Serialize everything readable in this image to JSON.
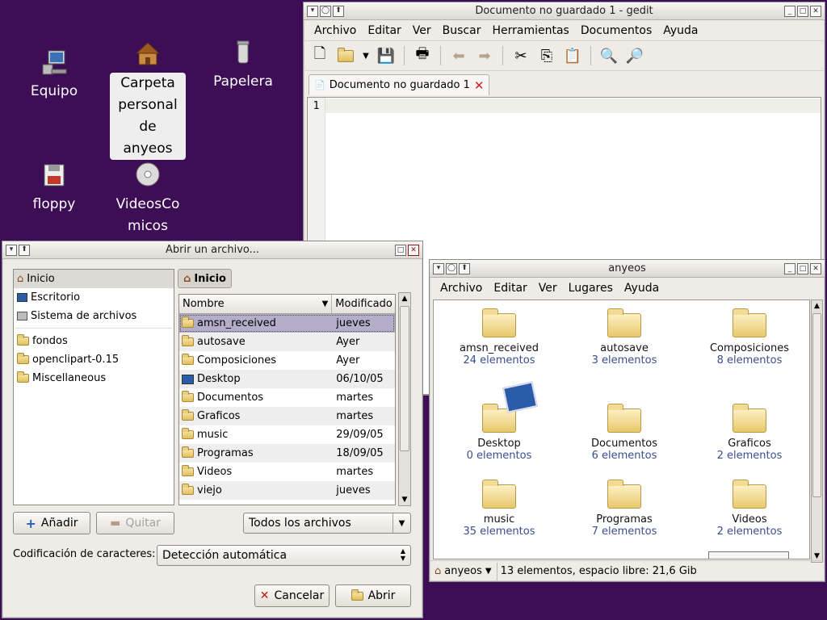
{
  "desktop": {
    "icons": [
      {
        "label": "Equipo",
        "icon": "computer-icon"
      },
      {
        "label": "Carpeta personal de anyeos",
        "icon": "home-folder-icon"
      },
      {
        "label": "Papelera",
        "icon": "trash-icon"
      },
      {
        "label": "floppy",
        "icon": "floppy-icon"
      },
      {
        "label": "VideosComicos",
        "icon": "cdrom-icon"
      }
    ]
  },
  "gedit": {
    "title": "Documento no guardado 1 - gedit",
    "menu": [
      "Archivo",
      "Editar",
      "Ver",
      "Buscar",
      "Herramientas",
      "Documentos",
      "Ayuda"
    ],
    "tab_label": "Documento no guardado 1",
    "line_number": "1"
  },
  "dialog": {
    "title": "Abrir un archivo...",
    "places": {
      "inicio": "Inicio",
      "escritorio": "Escritorio",
      "sistema": "Sistema de archivos",
      "bookmarks": [
        "fondos",
        "openclipart-0.15",
        "Miscellaneous"
      ]
    },
    "crumb": "Inicio",
    "columns": {
      "name": "Nombre",
      "modified": "Modificado"
    },
    "files": [
      {
        "name": "amsn_received",
        "modified": "jueves"
      },
      {
        "name": "autosave",
        "modified": "Ayer"
      },
      {
        "name": "Composiciones",
        "modified": "Ayer"
      },
      {
        "name": "Desktop",
        "modified": "06/10/05"
      },
      {
        "name": "Documentos",
        "modified": "martes"
      },
      {
        "name": "Graficos",
        "modified": "martes"
      },
      {
        "name": "music",
        "modified": "29/09/05"
      },
      {
        "name": "Programas",
        "modified": "18/09/05"
      },
      {
        "name": "Videos",
        "modified": "martes"
      },
      {
        "name": "viejo",
        "modified": "jueves"
      }
    ],
    "add_label": "Añadir",
    "remove_label": "Quitar",
    "filter": "Todos los archivos",
    "encoding_label": "Codificación de caracteres:",
    "encoding_value": "Detección automática",
    "cancel_label": "Cancelar",
    "open_label": "Abrir"
  },
  "nautilus": {
    "title": "anyeos",
    "menu": [
      "Archivo",
      "Editar",
      "Ver",
      "Lugares",
      "Ayuda"
    ],
    "items": [
      {
        "name": "amsn_received",
        "count": "24 elementos"
      },
      {
        "name": "autosave",
        "count": "3 elementos"
      },
      {
        "name": "Composiciones",
        "count": "8 elementos"
      },
      {
        "name": "Desktop",
        "count": "0 elementos"
      },
      {
        "name": "Documentos",
        "count": "6 elementos"
      },
      {
        "name": "Graficos",
        "count": "2 elementos"
      },
      {
        "name": "music",
        "count": "35 elementos"
      },
      {
        "name": "Programas",
        "count": "7 elementos"
      },
      {
        "name": "Videos",
        "count": "2 elementos"
      }
    ],
    "location": "anyeos",
    "status": "13 elementos, espacio libre: 21,6 Gib"
  }
}
